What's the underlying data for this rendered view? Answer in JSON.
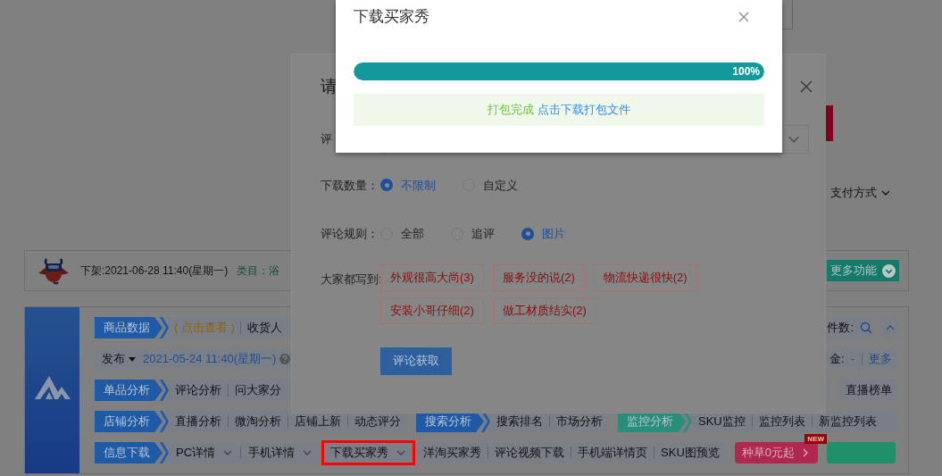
{
  "page": {
    "payment_filter": "支付方式",
    "product": {
      "delist": "下架:2021-06-28 11:40(星期一)",
      "category": "类目：浴",
      "more": "更多功能"
    },
    "toolbar_rows": [
      {
        "groups": [
          {
            "grow": true,
            "items": [
              {
                "kind": "tab",
                "label": "商品数据",
                "color": "#1f5aa6"
              },
              {
                "kind": "hint",
                "label": "( 点击查看 )"
              },
              {
                "kind": "text",
                "label": "收货人"
              }
            ]
          },
          {
            "items": [
              {
                "kind": "text",
                "label": "件数:"
              },
              {
                "kind": "search"
              }
            ]
          },
          {
            "items": [
              {
                "kind": "collapse"
              }
            ]
          }
        ]
      },
      {
        "groups": [
          {
            "grow": true,
            "items": [
              {
                "kind": "caret",
                "label": "发布"
              },
              {
                "kind": "date",
                "label": "2021-05-24 11:40(星期一)"
              },
              {
                "kind": "help"
              }
            ]
          },
          {
            "items": [
              {
                "kind": "text",
                "label": "金:"
              },
              {
                "kind": "value",
                "label": "-"
              },
              {
                "kind": "link",
                "label": "更多"
              }
            ]
          }
        ]
      },
      {
        "groups": [
          {
            "grow": true,
            "items": [
              {
                "kind": "tab",
                "label": "单品分析",
                "color": "#1f5aa6"
              },
              {
                "kind": "text",
                "label": "评论分析"
              },
              {
                "kind": "text",
                "label": "问大家分"
              }
            ]
          },
          {
            "items": [
              {
                "kind": "text",
                "label": "直播榜单"
              }
            ]
          }
        ]
      },
      {
        "groups": [
          {
            "items": [
              {
                "kind": "tab",
                "label": "店铺分析",
                "color": "#1f5aa6"
              },
              {
                "kind": "text",
                "label": "直播分析"
              },
              {
                "kind": "text",
                "label": "微淘分析"
              },
              {
                "kind": "text",
                "label": "店铺上新"
              },
              {
                "kind": "text",
                "label": "动态评分"
              }
            ]
          },
          {
            "items": [
              {
                "kind": "tab",
                "label": "搜索分析",
                "color": "#1f5aa6"
              },
              {
                "kind": "text",
                "label": "搜索排名"
              },
              {
                "kind": "text",
                "label": "市场分析"
              }
            ]
          },
          {
            "grow": true,
            "items": [
              {
                "kind": "tab",
                "label": "监控分析",
                "color": "#2a8f7a"
              },
              {
                "kind": "text",
                "label": "SKU监控"
              },
              {
                "kind": "text",
                "label": "监控列表"
              },
              {
                "kind": "text",
                "label": "新监控列表"
              }
            ]
          }
        ]
      },
      {
        "groups": [
          {
            "items": [
              {
                "kind": "tab",
                "label": "信息下载",
                "color": "#1f5aa6"
              },
              {
                "kind": "dropdown",
                "label": "PC详情",
                "highlighted": false
              },
              {
                "kind": "dropdown",
                "label": "手机详情",
                "highlighted": false
              },
              {
                "kind": "dropdown",
                "label": "下载买家秀",
                "highlighted": true
              },
              {
                "kind": "text",
                "label": "洋淘买家秀"
              },
              {
                "kind": "text",
                "label": "评论视频下载"
              },
              {
                "kind": "text",
                "label": "手机端详情页"
              },
              {
                "kind": "text",
                "label": "SKU图预览"
              }
            ]
          },
          {
            "items": [
              {
                "kind": "promo",
                "label": "种草0元起",
                "badge": "NEW"
              }
            ]
          },
          {
            "items": [
              {
                "kind": "action"
              }
            ]
          }
        ]
      }
    ]
  },
  "comment_dialog": {
    "title": "请",
    "field_label": "评",
    "quantity": {
      "label": "下载数量：",
      "options": [
        {
          "label": "不限制",
          "selected": true
        },
        {
          "label": "自定义",
          "selected": false
        }
      ]
    },
    "rule": {
      "label": "评论规则：",
      "options": [
        {
          "label": "全部",
          "selected": false
        },
        {
          "label": "追评",
          "selected": false
        },
        {
          "label": "图片",
          "selected": true
        }
      ]
    },
    "tags": {
      "label": "大家都写到:",
      "items": [
        "外观很高大尚(3)",
        "服务没的说(2)",
        "物流快递很快(2)",
        "安装小哥仔细(2)",
        "做工材质结实(2)"
      ]
    },
    "submit": "评论获取"
  },
  "download_dialog": {
    "title": "下载买家秀",
    "progress": {
      "level": 1,
      "label": "100%"
    },
    "status": "打包完成",
    "link": "点击下载打包文件"
  }
}
